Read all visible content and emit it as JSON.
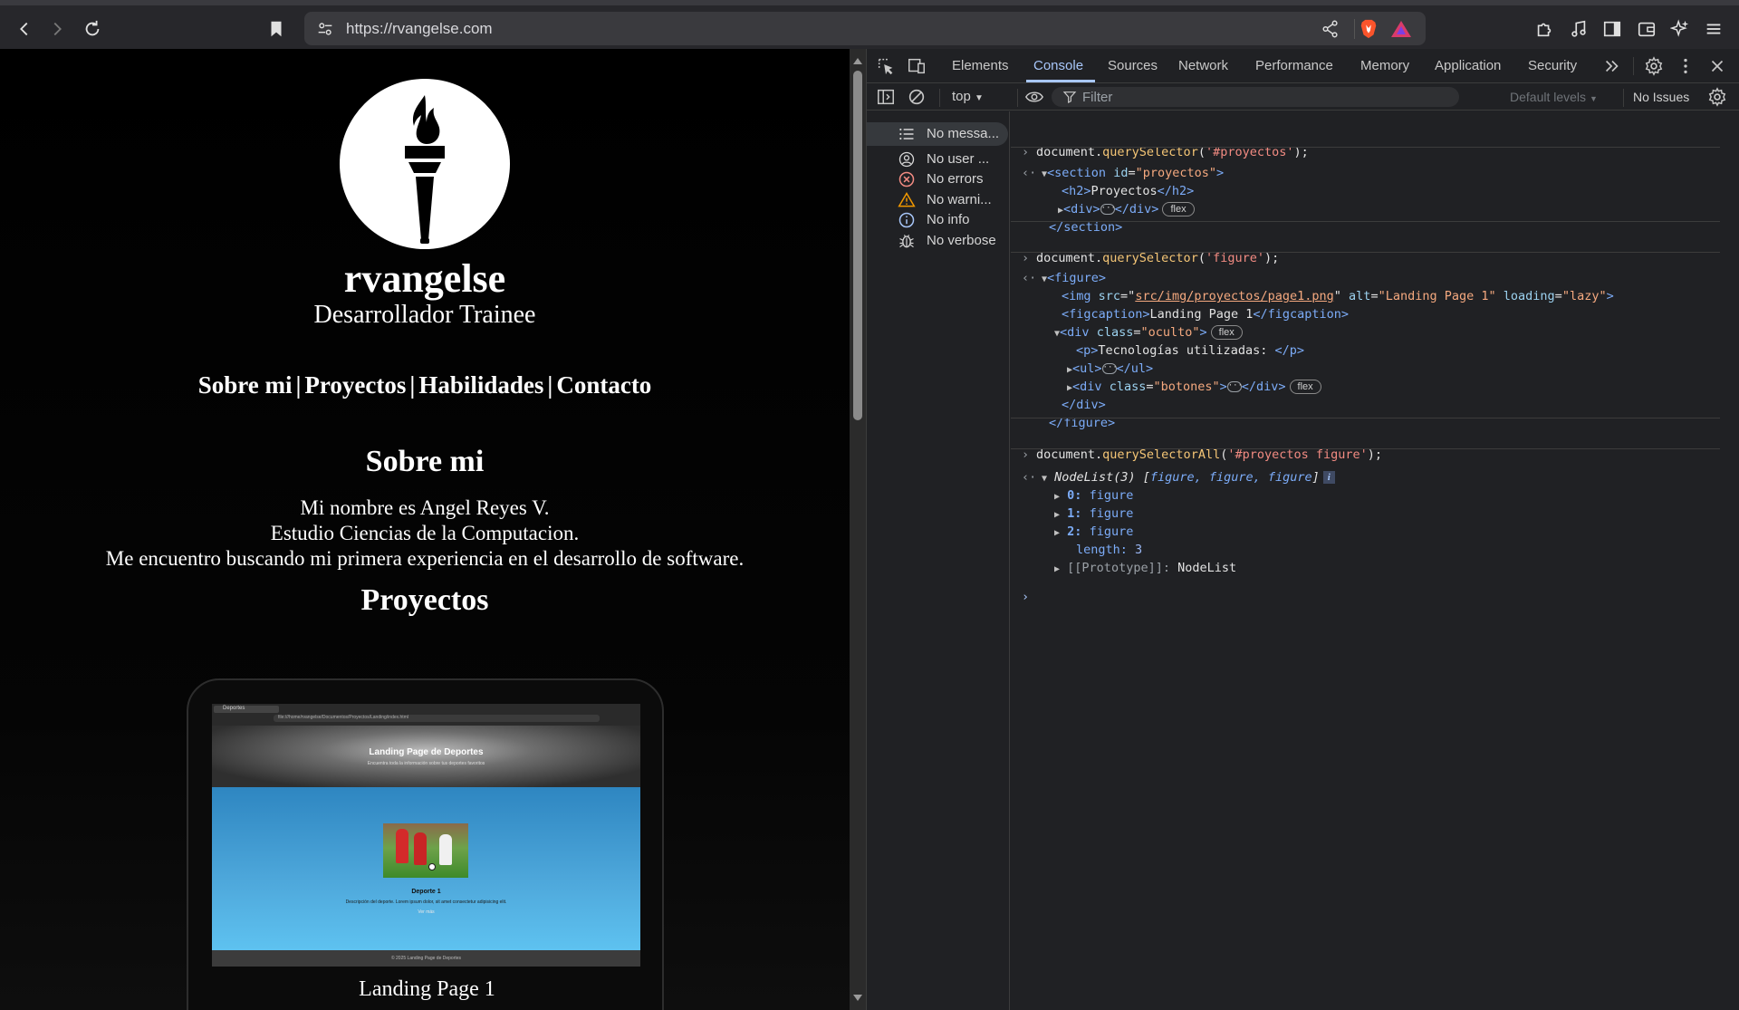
{
  "browser": {
    "url": "https://rvangelse.com"
  },
  "page": {
    "site_name": "rvangelse",
    "role": "Desarrollador Trainee",
    "nav": [
      "Sobre mi",
      "Proyectos",
      "Habilidades",
      "Contacto"
    ],
    "nav_separator": "|",
    "about_heading": "Sobre mi",
    "about_lines": [
      "Mi nombre es Angel Reyes V.",
      "Estudio Ciencias de la Computacion.",
      "Me encuentro buscando mi primera experiencia en el desarrollo de software."
    ],
    "projects_heading": "Proyectos",
    "project_card": {
      "caption": "Landing Page 1",
      "screenshot": {
        "tab": "Deportes",
        "url": "file:///home/rvangelse/Documentos/Proyectos/Landing/index.html",
        "hero_title": "Landing Page de Deportes",
        "hero_subtitle": "Encuentra toda la información sobre tus deportes favoritos",
        "sport_title": "Deporte 1",
        "sport_desc": "Descripción del deporte. Lorem ipsum dolor, sit amet consectetur adipisicing elit.",
        "more_link": "Ver más",
        "footer": "© 2025 Landing Page de Deportes"
      }
    }
  },
  "devtools": {
    "tabs": [
      "Elements",
      "Console",
      "Sources",
      "Network",
      "Performance",
      "Memory",
      "Application",
      "Security"
    ],
    "active_tab": "Console",
    "context": "top",
    "filter_placeholder": "Filter",
    "levels": "Default levels",
    "issues": "No Issues",
    "sidebar": [
      {
        "label": "No messa...",
        "icon": "list-icon"
      },
      {
        "label": "No user ...",
        "icon": "user-icon"
      },
      {
        "label": "No errors",
        "icon": "error-icon"
      },
      {
        "label": "No warni...",
        "icon": "warning-icon"
      },
      {
        "label": "No info",
        "icon": "info-icon"
      },
      {
        "label": "No verbose",
        "icon": "bug-icon"
      }
    ],
    "console": {
      "cmd1": {
        "obj": "document.",
        "fn": "querySelector",
        "open": "(",
        "arg": "'#proyectos'",
        "close": ");"
      },
      "res1": {
        "l1_tag": "<section",
        "l1_attr": "id",
        "l1_val": "\"proyectos\"",
        "l1_end": ">",
        "l2_open": "<h2>",
        "l2_text": "Proyectos",
        "l2_close": "</h2>",
        "l3_open": "<div>",
        "l3_close": "</div>",
        "l3_badge": "flex",
        "l4_close": "</section>"
      },
      "cmd2": {
        "obj": "document.",
        "fn": "querySelector",
        "open": "(",
        "arg": "'figure'",
        "close": ");"
      },
      "res2": {
        "l1": "<figure>",
        "img_tag": "<img",
        "img_src_attr": "src",
        "img_src": "src/img/proyectos/page1.png",
        "img_alt_attr": "alt",
        "img_alt": "\"Landing Page 1\"",
        "img_loading_attr": "loading",
        "img_loading": "\"lazy\"",
        "img_end": ">",
        "cap_open": "<figcaption>",
        "cap_text": "Landing Page 1",
        "cap_close": "</figcaption>",
        "div_tag": "<div",
        "div_attr": "class",
        "div_val": "\"oculto\"",
        "div_end": ">",
        "div_badge": "flex",
        "p_open": "<p>",
        "p_text": "Tecnologías utilizadas: ",
        "p_close": "</p>",
        "ul_open": "<ul>",
        "ul_close": "</ul>",
        "bot_tag": "<div",
        "bot_attr": "class",
        "bot_val": "\"botones\"",
        "bot_end": ">",
        "bot_close": "</div>",
        "bot_badge": "flex",
        "div_close": "</div>",
        "fig_close": "</figure>"
      },
      "cmd3": {
        "obj": "document.",
        "fn": "querySelectorAll",
        "open": "(",
        "arg": "'#proyectos figure'",
        "close": ");"
      },
      "res3": {
        "summary_pre": "NodeList(3) [",
        "summary_items": "figure, figure, figure",
        "summary_post": "]",
        "items": [
          {
            "key": "0:",
            "val": "figure"
          },
          {
            "key": "1:",
            "val": "figure"
          },
          {
            "key": "2:",
            "val": "figure"
          }
        ],
        "length_key": "length:",
        "length_val": "3",
        "proto_key": "[[Prototype]]:",
        "proto_val": "NodeList"
      }
    }
  }
}
